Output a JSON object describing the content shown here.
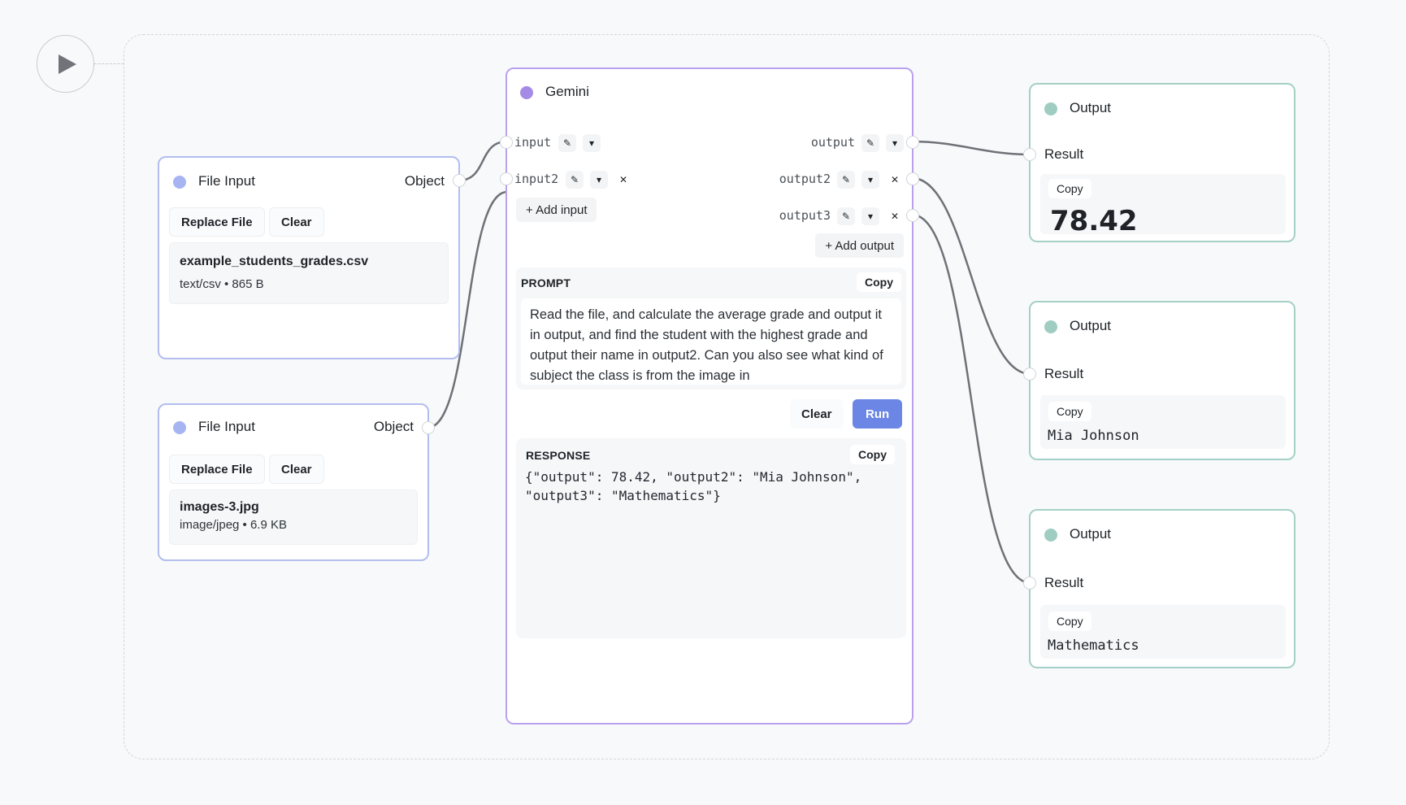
{
  "run_button": {
    "icon": "play-icon"
  },
  "file_inputs": [
    {
      "title": "File Input",
      "type": "Object",
      "replace_label": "Replace File",
      "clear_label": "Clear",
      "file_name": "example_students_grades.csv",
      "file_meta": "text/csv • 865 B"
    },
    {
      "title": "File Input",
      "type": "Object",
      "replace_label": "Replace File",
      "clear_label": "Clear",
      "file_name": "images-3.jpg",
      "file_meta": "image/jpeg • 6.9 KB"
    }
  ],
  "gemini": {
    "title": "Gemini",
    "inputs": [
      {
        "name": "input"
      },
      {
        "name": "input2"
      }
    ],
    "outputs": [
      {
        "name": "output"
      },
      {
        "name": "output2"
      },
      {
        "name": "output3"
      }
    ],
    "add_input_label": "+ Add input",
    "add_output_label": "+ Add output",
    "prompt_heading": "PROMPT",
    "copy_label": "Copy",
    "prompt_text": "Read the file, and calculate the average grade and output it in output, and find the student with the highest grade and output their name in output2. Can you also see what kind of subject the class is from the image in",
    "clear_label": "Clear",
    "run_label": "Run",
    "response_heading": "RESPONSE",
    "response_text": "{\"output\": 78.42, \"output2\": \"Mia Johnson\",\n\"output3\": \"Mathematics\"}"
  },
  "outputs": [
    {
      "title": "Output",
      "result_label": "Result",
      "copy_label": "Copy",
      "value": "78.42"
    },
    {
      "title": "Output",
      "result_label": "Result",
      "copy_label": "Copy",
      "value": "Mia Johnson"
    },
    {
      "title": "Output",
      "result_label": "Result",
      "copy_label": "Copy",
      "value": "Mathematics"
    }
  ],
  "colors": {
    "file_node_border": "#b3bdf0",
    "gemini_node_border": "#b9a1ee",
    "output_node_border": "#a5d0c6",
    "run_button": "#6b86e5"
  }
}
